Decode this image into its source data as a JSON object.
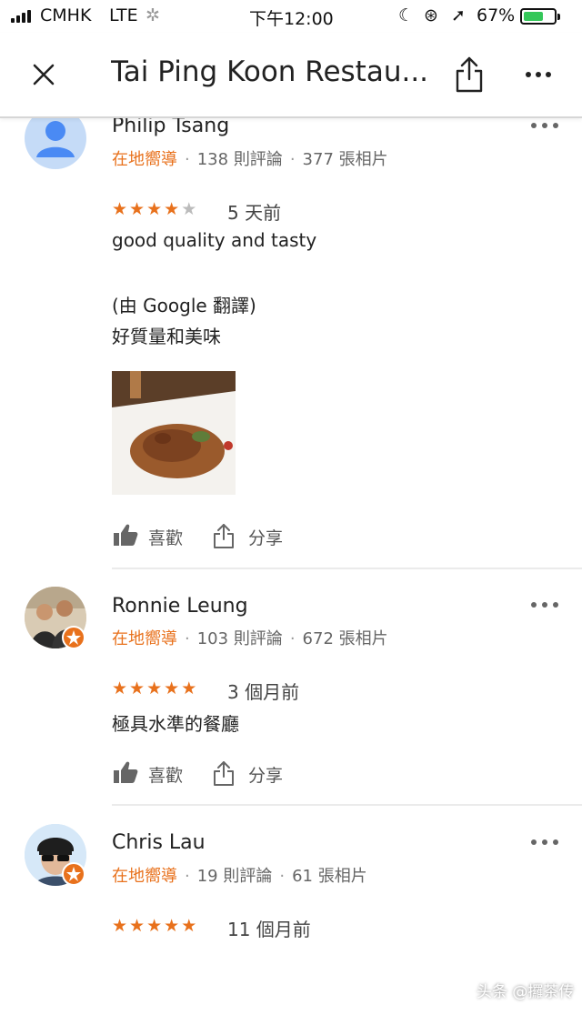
{
  "status_bar": {
    "carrier": "CMHK",
    "network": "LTE",
    "time": "下午12:00",
    "battery_percent": "67%",
    "battery_level": 0.67,
    "battery_color": "#34c759"
  },
  "header": {
    "title": "Tai Ping Koon Restau..."
  },
  "accent_color": "#e8711c",
  "reviews": [
    {
      "name": "Philip Tsang",
      "local_guide": "在地嚮導",
      "review_count": "138 則評論",
      "photo_count": "377 張相片",
      "rating": 4,
      "time_ago": "5 天前",
      "text": "good quality and tasty",
      "translation_note": "(由 Google 翻譯)",
      "translated_text": "好質量和美味",
      "has_photo": true,
      "like_label": "喜歡",
      "share_label": "分享"
    },
    {
      "name": "Ronnie Leung",
      "local_guide": "在地嚮導",
      "review_count": "103 則評論",
      "photo_count": "672 張相片",
      "rating": 5,
      "time_ago": "3 個月前",
      "text": "極具水準的餐廳",
      "like_label": "喜歡",
      "share_label": "分享"
    },
    {
      "name": "Chris Lau",
      "local_guide": "在地嚮導",
      "review_count": "19 則評論",
      "photo_count": "61 張相片",
      "rating": 5,
      "time_ago": "11 個月前"
    }
  ],
  "watermark": "头条 @攞茶传"
}
